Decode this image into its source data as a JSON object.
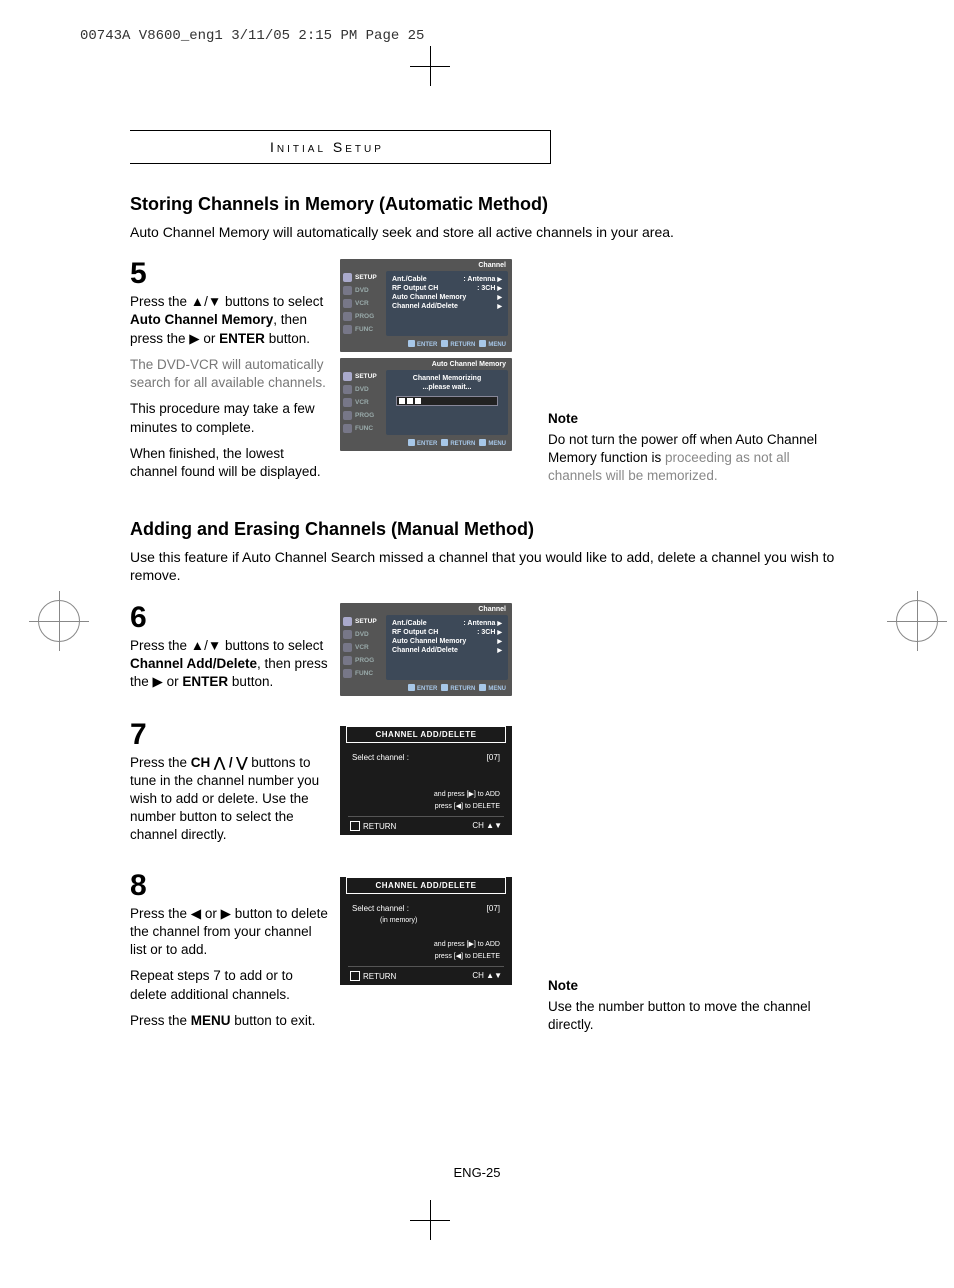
{
  "print_header": "00743A V8600_eng1  3/11/05  2:15 PM  Page 25",
  "chapter": "Initial Setup",
  "page_number": "ENG-25",
  "sec1": {
    "title": "Storing Channels in Memory (Automatic Method)",
    "intro": "Auto Channel Memory will automatically seek and store all active channels in your area."
  },
  "step5": {
    "num": "5",
    "p1a": "Press the ▲/▼ buttons to select ",
    "p1b": "Auto Channel Memory",
    "p1c": ", then press the ▶ or ",
    "p1d": "ENTER",
    "p1e": " button.",
    "p2": "The DVD-VCR will automatically search for all available channels.",
    "p3": "This procedure may take a few minutes to complete.",
    "p4": "When finished, the lowest channel found will be displayed."
  },
  "osd1": {
    "corner": "Channel",
    "side": [
      "SETUP",
      "DVD",
      "VCR",
      "PROG",
      "FUNC"
    ],
    "lines": [
      {
        "l": "Ant./Cable",
        "r": ": Antenna"
      },
      {
        "l": "RF Output CH",
        "r": ": 3CH"
      },
      {
        "l": "Auto Channel Memory",
        "r": ""
      },
      {
        "l": "Channel Add/Delete",
        "r": ""
      }
    ],
    "foot": [
      "ENTER",
      "RETURN",
      "MENU"
    ]
  },
  "osd2": {
    "corner": "Auto Channel Memory",
    "line1": "Channel Memorizing",
    "line2": "...please  wait..."
  },
  "note1": {
    "label": "Note",
    "t1": "Do not turn the power off when Auto Channel Memory function is ",
    "t2": "proceeding as not all channels will be memorized."
  },
  "sec2": {
    "title": "Adding and Erasing Channels (Manual Method)",
    "intro": "Use this feature if Auto Channel Search missed a channel that you would like to add, delete a channel you wish to remove."
  },
  "step6": {
    "num": "6",
    "p1a": "Press the ▲/▼ buttons to select ",
    "p1b": "Channel Add/Delete",
    "p1c": ", then press the ▶ or ",
    "p1d": "ENTER",
    "p1e": " button."
  },
  "step7": {
    "num": "7",
    "p1a": "Press the ",
    "p1b": "CH ",
    "p1c": " buttons to tune in the channel number you wish to add or delete. Use the number button to select the channel directly."
  },
  "step8": {
    "num": "8",
    "p1": "Press the ◀ or ▶ button to delete the channel from your channel list or to add.",
    "p2": "Repeat steps 7 to add or to delete additional channels.",
    "p3a": "Press the ",
    "p3b": "MENU",
    "p3c": " button to exit."
  },
  "dark1": {
    "title": "CHANNEL ADD/DELETE",
    "sel": "Select channel :",
    "ch": "[07]",
    "hint1": "and press [▶] to ADD",
    "hint2": "press [◀] to DELETE",
    "ret": "RETURN",
    "chbtn": "CH ▲▼"
  },
  "dark2": {
    "title": "CHANNEL ADD/DELETE",
    "sel": "Select channel :",
    "sub": "(in memory)",
    "ch": "[07]",
    "hint1": "and press [▶] to ADD",
    "hint2": "press [◀] to DELETE",
    "ret": "RETURN",
    "chbtn": "CH ▲▼"
  },
  "note2": {
    "label": "Note",
    "text": "Use the number button to move the channel directly."
  }
}
